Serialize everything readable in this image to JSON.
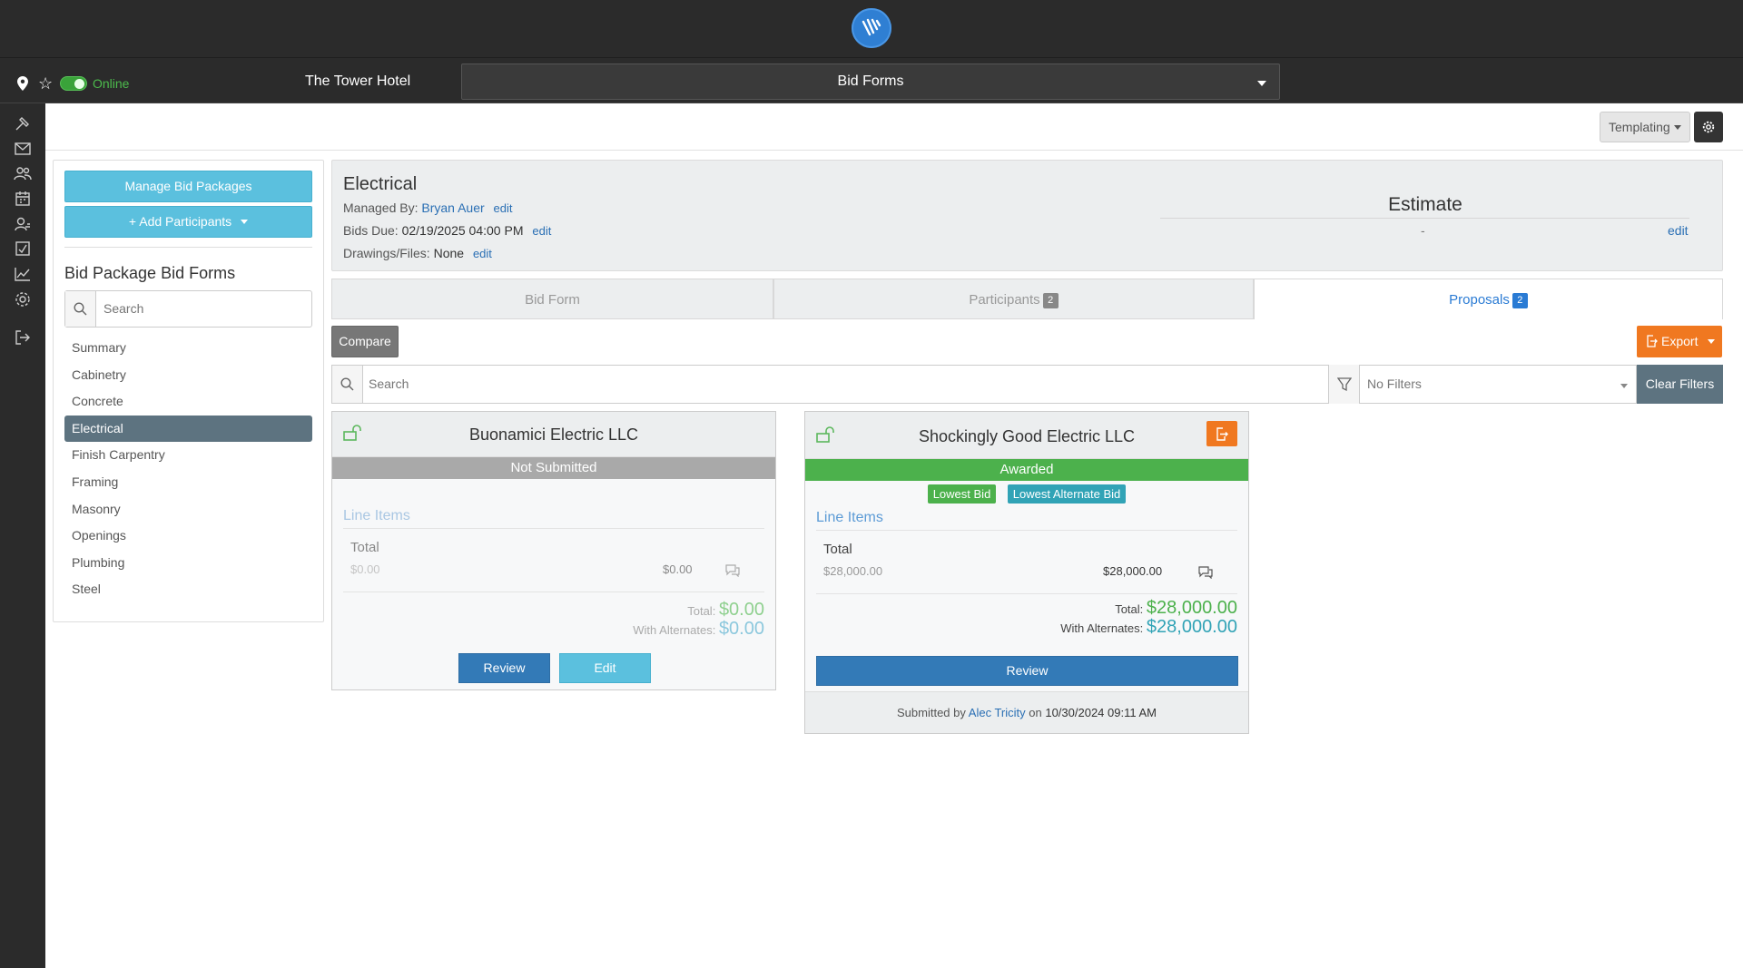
{
  "app": {
    "project": "The Tower Hotel",
    "module": "Bid Forms",
    "online_label": "Online"
  },
  "toolbar": {
    "templating_label": "Templating"
  },
  "sidebar": {
    "manage_label": "Manage Bid Packages",
    "add_participants_label": "Add Participants",
    "heading": "Bid Package Bid Forms",
    "search_placeholder": "Search",
    "items": [
      "Summary",
      "Cabinetry",
      "Concrete",
      "Electrical",
      "Finish Carpentry",
      "Framing",
      "Masonry",
      "Openings",
      "Plumbing",
      "Steel"
    ],
    "active_item": "Electrical"
  },
  "header": {
    "title": "Electrical",
    "managed_by_label": "Managed By:",
    "managed_by": "Bryan Auer",
    "bids_due_label": "Bids Due:",
    "bids_due": "02/19/2025 04:00 PM",
    "drawings_label": "Drawings/Files:",
    "drawings": "None",
    "edit_label": "edit",
    "estimate_label": "Estimate",
    "estimate_value": "-"
  },
  "tabs": [
    {
      "label": "Bid Form",
      "badge": ""
    },
    {
      "label": "Participants",
      "badge": "2"
    },
    {
      "label": "Proposals",
      "badge": "2"
    }
  ],
  "actions": {
    "compare_label": "Compare",
    "export_label": "Export",
    "search_placeholder": "Search",
    "filter_value": "No Filters",
    "clear_filters_label": "Clear Filters"
  },
  "cards": [
    {
      "name": "Buonamici Electric LLC",
      "status": "Not Submitted",
      "line_items_label": "Line Items",
      "total_label": "Total",
      "left_amount": "$0.00",
      "right_amount": "$0.00",
      "total_caption": "Total:",
      "total_value": "$0.00",
      "alt_caption": "With Alternates:",
      "alt_value": "$0.00",
      "review_label": "Review",
      "edit_label": "Edit"
    },
    {
      "name": "Shockingly Good Electric LLC",
      "status": "Awarded",
      "tags": [
        "Lowest Bid",
        "Lowest Alternate Bid"
      ],
      "line_items_label": "Line Items",
      "total_label": "Total",
      "left_amount": "$28,000.00",
      "right_amount": "$28,000.00",
      "total_caption": "Total:",
      "total_value": "$28,000.00",
      "alt_caption": "With Alternates:",
      "alt_value": "$28,000.00",
      "review_label": "Review",
      "submitted_prefix": "Submitted by",
      "submitted_by": "Alec Tricity",
      "submitted_on": "on",
      "submitted_date": "10/30/2024 09:11 AM"
    }
  ],
  "colors": {
    "cyan": "#5bc0de",
    "slate": "#5d7380",
    "orange": "#f07820",
    "green": "#4cb14c",
    "blue": "#337ab7",
    "teal": "#31a3b6"
  }
}
